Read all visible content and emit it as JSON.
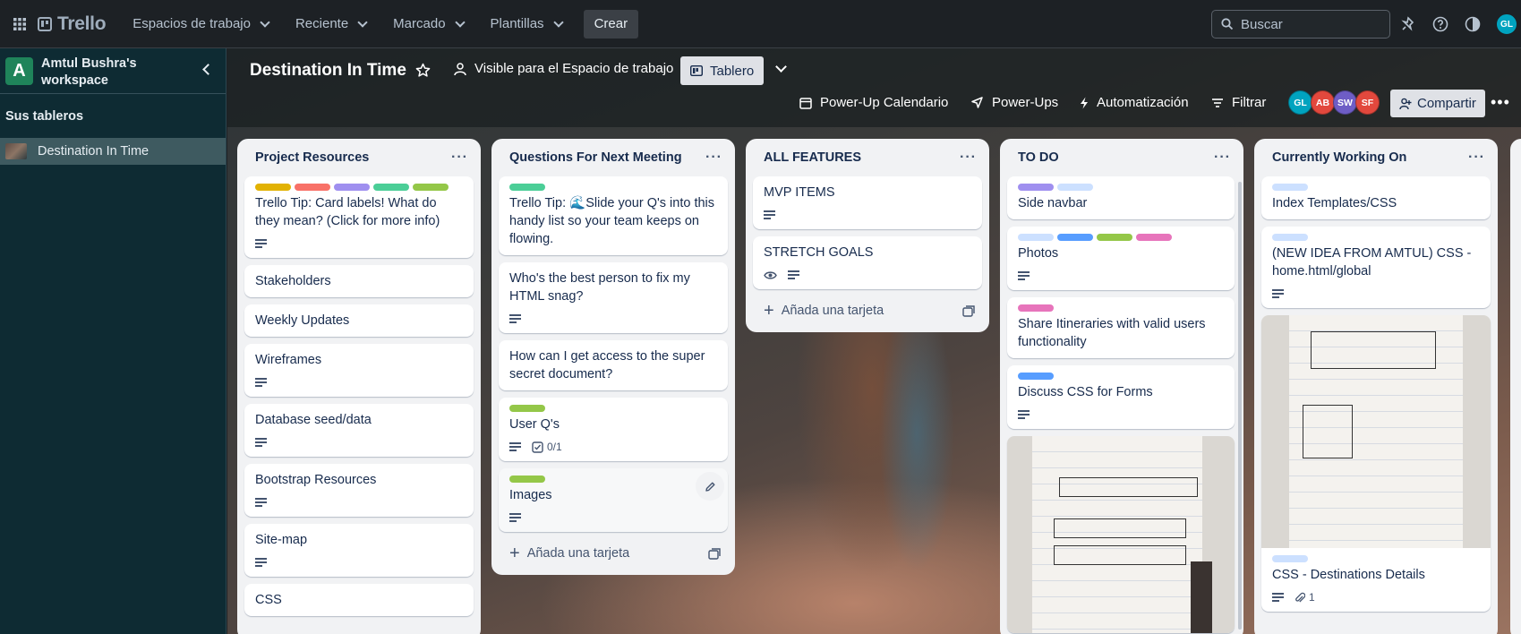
{
  "topbar": {
    "app_name": "Trello",
    "nav": [
      "Espacios de trabajo",
      "Reciente",
      "Marcado",
      "Plantillas"
    ],
    "create_label": "Crear",
    "search_placeholder": "Buscar",
    "user_initials": "GL"
  },
  "sidebar": {
    "workspace_initial": "A",
    "workspace_name": "Amtul Bushra's workspace",
    "section_title": "Sus tableros",
    "boards": [
      "Destination In Time"
    ]
  },
  "board": {
    "title": "Destination In Time",
    "visibility": "Visible para el Espacio de trabajo",
    "view_label": "Tablero",
    "tools": {
      "calendar": "Power-Up Calendario",
      "powerups": "Power-Ups",
      "automation": "Automatización",
      "filter": "Filtrar",
      "share": "Compartir"
    },
    "members": [
      {
        "initials": "GL",
        "color": "#00a3bf"
      },
      {
        "initials": "AB",
        "color": "#e2483d"
      },
      {
        "initials": "SW",
        "color": "#6e5dc6"
      },
      {
        "initials": "SF",
        "color": "#e2483d"
      }
    ]
  },
  "lists": [
    {
      "title": "Project Resources",
      "cards": [
        {
          "title": "Trello Tip: Card labels! What do they mean? (Click for more info)",
          "labels": [
            "#e2b203",
            "#f87168",
            "#9f8fef",
            "#4bce97",
            "#94c748"
          ],
          "description": true
        },
        {
          "title": "Stakeholders"
        },
        {
          "title": "Weekly Updates"
        },
        {
          "title": "Wireframes",
          "description": true
        },
        {
          "title": "Database seed/data",
          "description": true
        },
        {
          "title": "Bootstrap Resources",
          "description": true
        },
        {
          "title": "Site-map",
          "description": true
        },
        {
          "title": "CSS"
        }
      ]
    },
    {
      "title": "Questions For Next Meeting",
      "cards": [
        {
          "title": "Trello Tip: 🌊Slide your Q's into this handy list so your team keeps on flowing.",
          "labels": [
            "#4bce97"
          ]
        },
        {
          "title": "Who's the best person to fix my HTML snag?",
          "description": true
        },
        {
          "title": "How can I get access to the super secret document?"
        },
        {
          "title": "User Q's",
          "labels": [
            "#94c748"
          ],
          "description": true,
          "checklist": "0/1"
        },
        {
          "title": "Images",
          "labels": [
            "#94c748"
          ],
          "description": true
        }
      ],
      "add_card": "Añada una tarjeta"
    },
    {
      "title": "ALL FEATURES",
      "cards": [
        {
          "title": "MVP ITEMS",
          "description": true
        },
        {
          "title": "STRETCH GOALS",
          "description": true,
          "watching": true
        }
      ],
      "add_card": "Añada una tarjeta"
    },
    {
      "title": "TO DO",
      "cards": [
        {
          "title": "Side navbar",
          "labels": [
            "#9f8fef",
            "#cce0ff"
          ]
        },
        {
          "title": "Photos",
          "labels": [
            "#cce0ff",
            "#579dff",
            "#94c748",
            "#e774bb"
          ],
          "description": true
        },
        {
          "title": "Share Itineraries with valid users functionality",
          "labels": [
            "#e774bb"
          ]
        },
        {
          "title": "Discuss CSS for Forms",
          "labels": [
            "#579dff"
          ],
          "description": true
        }
      ]
    },
    {
      "title": "Currently Working On",
      "cards": [
        {
          "title": "Index Templates/CSS",
          "labels": [
            "#cce0ff"
          ]
        },
        {
          "title": "(NEW IDEA FROM AMTUL) CSS - home.html/global",
          "labels": [
            "#cce0ff"
          ],
          "description": true
        },
        {
          "title": "CSS - Destinations Details",
          "labels": [
            "#cce0ff"
          ],
          "description": true,
          "attachments": "1"
        }
      ]
    }
  ]
}
